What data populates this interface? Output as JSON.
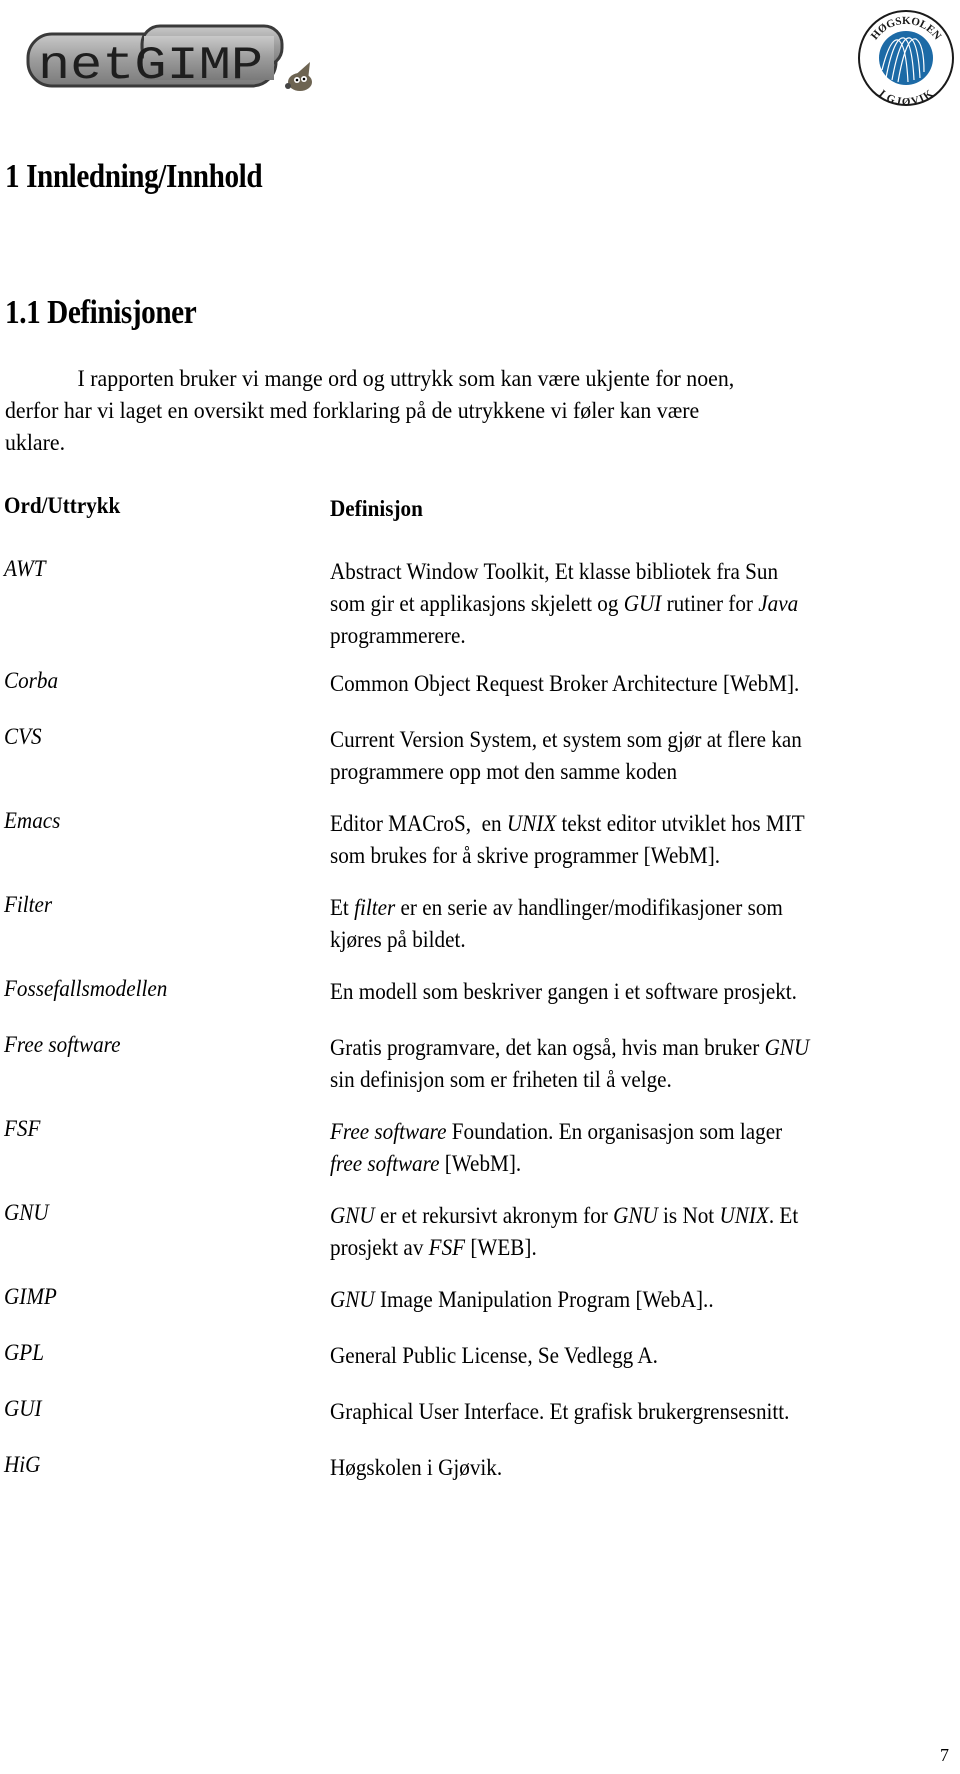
{
  "header": {
    "left_logo_text": "netGIMP",
    "right_logo_top_text": "HØGSKOLEN",
    "right_logo_bottom_text": "I GJØVIK",
    "brand_colors": {
      "hig_blue": "#1c6aa6",
      "gimp_gray": "#9a9a9a"
    }
  },
  "section": {
    "heading1": "1 Innledning/Innhold",
    "heading2": "1.1 Definisjoner",
    "intro_line1": "I rapporten bruker vi mange ord og uttrykk som kan være ukjente for noen,",
    "intro_line2": "derfor har vi laget en oversikt med forklaring på de utrykkene vi føler kan være",
    "intro_line3": "uklare."
  },
  "table": {
    "col_term": "Ord/Uttrykk",
    "col_def": "Definisjon",
    "rows": [
      {
        "term": "AWT",
        "lines": [
          [
            {
              "t": "Abstract Window Toolkit, Et klasse bibliotek fra Sun"
            }
          ],
          [
            {
              "t": "som gir et applikasjons skjelett og "
            },
            {
              "t": "GUI",
              "i": true
            },
            {
              "t": " rutiner for "
            },
            {
              "t": "Java",
              "i": true
            }
          ],
          [
            {
              "t": "programmerere."
            }
          ]
        ]
      },
      {
        "term": "Corba",
        "lines": [
          [
            {
              "t": "Common Object Request Broker Architecture [WebM]."
            }
          ]
        ]
      },
      {
        "term": "CVS",
        "lines": [
          [
            {
              "t": "Current Version System, et system som gjør at flere kan"
            }
          ],
          [
            {
              "t": "programmere opp mot den samme koden"
            }
          ]
        ]
      },
      {
        "term": "Emacs",
        "lines": [
          [
            {
              "t": "Editor MACroS,  en "
            },
            {
              "t": "UNIX",
              "i": true
            },
            {
              "t": " tekst editor utviklet hos MIT"
            }
          ],
          [
            {
              "t": "som brukes for å skrive programmer [WebM]."
            }
          ]
        ]
      },
      {
        "term": "Filter",
        "lines": [
          [
            {
              "t": "Et "
            },
            {
              "t": "filter",
              "i": true
            },
            {
              "t": " er en serie av handlinger/modifikasjoner som"
            }
          ],
          [
            {
              "t": "kjøres på bildet."
            }
          ]
        ]
      },
      {
        "term": "Fossefallsmodellen",
        "lines": [
          [
            {
              "t": "En modell som beskriver gangen i et software prosjekt."
            }
          ]
        ]
      },
      {
        "term": "Free software",
        "lines": [
          [
            {
              "t": "Gratis programvare, det kan også, hvis man bruker "
            },
            {
              "t": "GNU",
              "i": true
            }
          ],
          [
            {
              "t": "sin definisjon som er friheten til å velge."
            }
          ]
        ]
      },
      {
        "term": "FSF",
        "lines": [
          [
            {
              "t": "Free software",
              "i": true
            },
            {
              "t": " Foundation. En organisasjon som lager"
            }
          ],
          [
            {
              "t": "free software",
              "i": true
            },
            {
              "t": " [WebM]."
            }
          ]
        ]
      },
      {
        "term": "GNU",
        "lines": [
          [
            {
              "t": "GNU",
              "i": true
            },
            {
              "t": " er et rekursivt akronym for "
            },
            {
              "t": "GNU",
              "i": true
            },
            {
              "t": " is Not "
            },
            {
              "t": "UNIX",
              "i": true
            },
            {
              "t": ". Et"
            }
          ],
          [
            {
              "t": "prosjekt av "
            },
            {
              "t": "FSF",
              "i": true
            },
            {
              "t": " [WEB]."
            }
          ]
        ]
      },
      {
        "term": "GIMP",
        "lines": [
          [
            {
              "t": "GNU",
              "i": true
            },
            {
              "t": " Image Manipulation Program [WebA].."
            }
          ]
        ]
      },
      {
        "term": "GPL",
        "lines": [
          [
            {
              "t": "General Public License, Se Vedlegg A."
            }
          ]
        ]
      },
      {
        "term": "GUI",
        "lines": [
          [
            {
              "t": "Graphical User Interface. Et grafisk brukergrensesnitt."
            }
          ]
        ]
      },
      {
        "term": "HiG",
        "lines": [
          [
            {
              "t": "Høgskolen i Gjøvik."
            }
          ]
        ]
      }
    ]
  },
  "footer": {
    "page_number": "7"
  }
}
